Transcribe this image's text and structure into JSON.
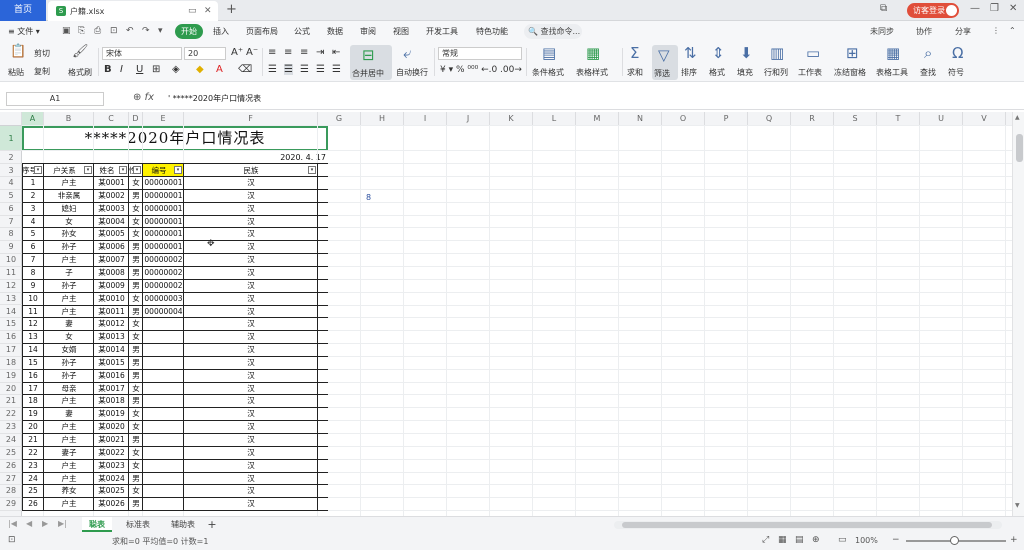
{
  "titlebar": {
    "home_tab": "首页",
    "file_tab": "户籍.xlsx",
    "file_icon": "S",
    "new_tab": "+",
    "visitor_label": "访客登录"
  },
  "menubar": {
    "file_menu": "≡ 文件 ▾",
    "items": [
      "开始",
      "插入",
      "页面布局",
      "公式",
      "数据",
      "审阅",
      "视图",
      "开发工具",
      "特色功能"
    ],
    "search": "查找命令...",
    "right": [
      "未同步",
      "协作",
      "分享"
    ]
  },
  "ribbon": {
    "paste": "粘贴",
    "cut": "剪切",
    "copy": "复制",
    "format_painter": "格式刷",
    "font_name": "宋体",
    "font_size": "20",
    "merge": "合并居中",
    "wrap": "自动换行",
    "number_format": "常规",
    "cond_format": "条件格式",
    "table_style": "表格样式",
    "sum": "求和",
    "filter": "筛选",
    "sort": "排序",
    "format": "格式",
    "fill": "填充",
    "row_col": "行和列",
    "worksheet": "工作表",
    "freeze": "冻结窗格",
    "table_tools": "表格工具",
    "find": "查找",
    "symbol": "符号"
  },
  "formula": {
    "cell_ref": "A1",
    "content": "' *****2020年户口情况表"
  },
  "sheet": {
    "columns": [
      "A",
      "B",
      "C",
      "D",
      "E",
      "F",
      "G",
      "H",
      "I",
      "J",
      "K",
      "L",
      "M",
      "N",
      "O",
      "P",
      "Q",
      "R",
      "S",
      "T",
      "U",
      "V"
    ],
    "row_numbers": [
      "1",
      "2",
      "3",
      "4",
      "5",
      "6",
      "7",
      "8",
      "9",
      "10",
      "11",
      "12",
      "13",
      "14",
      "15",
      "16",
      "17",
      "18",
      "19",
      "20",
      "21",
      "22",
      "23",
      "24",
      "25",
      "26",
      "27",
      "28",
      "29"
    ],
    "title": "*****2020年户口情况表",
    "date": "2020. 4. 17",
    "headers": [
      "序号",
      "户关系",
      "姓名",
      "性别",
      "编号",
      "民族"
    ],
    "g4_value": "8",
    "rows": [
      [
        "1",
        "户主",
        "某0001",
        "女",
        "00000001",
        "汉"
      ],
      [
        "2",
        "非亲属",
        "某0002",
        "男",
        "00000001",
        "汉"
      ],
      [
        "3",
        "媳妇",
        "某0003",
        "女",
        "00000001",
        "汉"
      ],
      [
        "4",
        "女",
        "某0004",
        "女",
        "00000001",
        "汉"
      ],
      [
        "5",
        "孙女",
        "某0005",
        "女",
        "00000001",
        "汉"
      ],
      [
        "6",
        "孙子",
        "某0006",
        "男",
        "00000001",
        "汉"
      ],
      [
        "7",
        "户主",
        "某0007",
        "男",
        "00000002",
        "汉"
      ],
      [
        "8",
        "子",
        "某0008",
        "男",
        "00000002",
        "汉"
      ],
      [
        "9",
        "孙子",
        "某0009",
        "男",
        "00000002",
        "汉"
      ],
      [
        "10",
        "户主",
        "某0010",
        "女",
        "00000003",
        "汉"
      ],
      [
        "11",
        "户主",
        "某0011",
        "男",
        "00000004",
        "汉"
      ],
      [
        "12",
        "妻",
        "某0012",
        "女",
        "",
        "汉"
      ],
      [
        "13",
        "女",
        "某0013",
        "女",
        "",
        "汉"
      ],
      [
        "14",
        "女婿",
        "某0014",
        "男",
        "",
        "汉"
      ],
      [
        "15",
        "孙子",
        "某0015",
        "男",
        "",
        "汉"
      ],
      [
        "16",
        "孙子",
        "某0016",
        "男",
        "",
        "汉"
      ],
      [
        "17",
        "母亲",
        "某0017",
        "女",
        "",
        "汉"
      ],
      [
        "18",
        "户主",
        "某0018",
        "男",
        "",
        "汉"
      ],
      [
        "19",
        "妻",
        "某0019",
        "女",
        "",
        "汉"
      ],
      [
        "20",
        "户主",
        "某0020",
        "女",
        "",
        "汉"
      ],
      [
        "21",
        "户主",
        "某0021",
        "男",
        "",
        "汉"
      ],
      [
        "22",
        "妻子",
        "某0022",
        "女",
        "",
        "汉"
      ],
      [
        "23",
        "户主",
        "某0023",
        "女",
        "",
        "汉"
      ],
      [
        "24",
        "户主",
        "某0024",
        "男",
        "",
        "汉"
      ],
      [
        "25",
        "养女",
        "某0025",
        "女",
        "",
        "汉"
      ],
      [
        "26",
        "户主",
        "某0026",
        "男",
        "",
        "汉"
      ]
    ]
  },
  "sheet_tabs": [
    "聪表",
    "标准表",
    "辅助表"
  ],
  "status": {
    "summary": "求和=0  平均值=0  计数=1",
    "zoom": "100%"
  },
  "colors": {
    "accent_green": "#2e9b4e",
    "home_blue": "#2b65d9",
    "highlight_yellow": "#fff200",
    "visitor_red": "#e04e3a"
  }
}
